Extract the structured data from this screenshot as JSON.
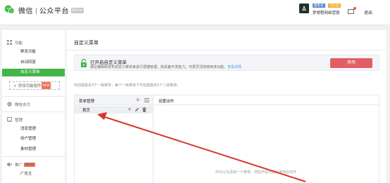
{
  "header": {
    "brand_name": "微信",
    "brand_sub": "公众平台",
    "brand_badge": "Beta",
    "account_type": "服务号",
    "verified": "已认证",
    "account_name": "梦想程网络营销",
    "logout": "退出"
  },
  "sidebar": {
    "function_title": "功能",
    "function_items": [
      "群发功能",
      "自动回复",
      "自定义菜单"
    ],
    "add_plugin": "+ 添加功能插件",
    "add_plugin_tag": "NEW",
    "wechat_pay": "微信支付",
    "manage_title": "管理",
    "manage_items": [
      "消息管理",
      "用户管理",
      "素材管理"
    ],
    "promo_title": "推广",
    "promo_tag": "NEW",
    "promo_items": [
      "广告主"
    ]
  },
  "main": {
    "title": "自定义菜单",
    "notice_title": "已开启自定义菜单",
    "notice_desc": "通过编辑和发布自定义菜单来进行便捷管理，如具备开发能力，可更灵活地使用该功能。",
    "notice_link": "查看详情",
    "disable_button": "停用",
    "hint": "可创建最多3个一级菜单，每个一级菜单下可创建最多5个二级菜单。",
    "menu_manage_header": "菜单管理",
    "action_header": "设置动作",
    "menu_items": [
      "首页"
    ],
    "action_empty_text": "你可以先添加一个菜单，然后开始为其设置响应动作"
  },
  "colors": {
    "accent_green": "#44b549",
    "danger_red": "#e15f63",
    "link_blue": "#459ae9",
    "annotation_arrow": "#d9342b"
  },
  "icons": [
    "wechat-logo-icon",
    "mail-icon",
    "function-icon",
    "wechat-pay-icon",
    "manage-icon",
    "promo-icon",
    "lock-icon",
    "plus-icon",
    "list-icon",
    "edit-icon",
    "delete-icon"
  ]
}
